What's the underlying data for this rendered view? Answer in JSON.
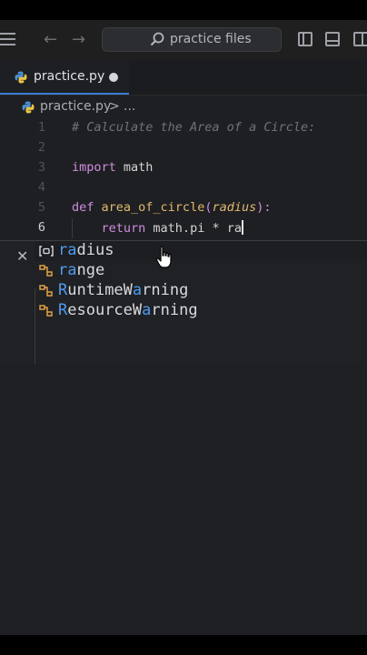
{
  "titlebar": {
    "search_label": "practice files"
  },
  "tab": {
    "label": "practice.py"
  },
  "breadcrumb": {
    "file": "practice.py",
    "separator": ">",
    "more": "..."
  },
  "editor": {
    "lines": [
      {
        "num": "1",
        "text": "# Calculate the Area of a Circle:"
      },
      {
        "num": "2",
        "text": ""
      },
      {
        "num": "3",
        "kw": "import",
        "rest": " math"
      },
      {
        "num": "4",
        "text": ""
      },
      {
        "num": "5",
        "kw": "def",
        "fn": "area_of_circle",
        "open": "(",
        "param": "radius",
        "close": "):"
      },
      {
        "num": "6",
        "kw": "return",
        "rest": " math.pi * ra"
      }
    ]
  },
  "suggestions": {
    "match_prefix_note": "ra",
    "items": [
      {
        "prefix": "ra",
        "suffix": "dius",
        "kind": "variable-icon"
      },
      {
        "prefix": "ra",
        "suffix": "nge",
        "kind": "class-icon"
      },
      {
        "prefix": "R",
        "mid": "untimeW",
        "hi2": "a",
        "suffix": "rning",
        "kind": "class-icon"
      },
      {
        "prefix": "R",
        "mid": "esourceW",
        "hi2": "a",
        "suffix": "rning",
        "kind": "class-icon"
      }
    ]
  },
  "colors": {
    "background": "#1e1f22",
    "accent": "#3d7bd9",
    "keyword": "#cf8ee0",
    "function": "#e0b970",
    "comment": "#6f7378",
    "match": "#4f9bf0"
  }
}
